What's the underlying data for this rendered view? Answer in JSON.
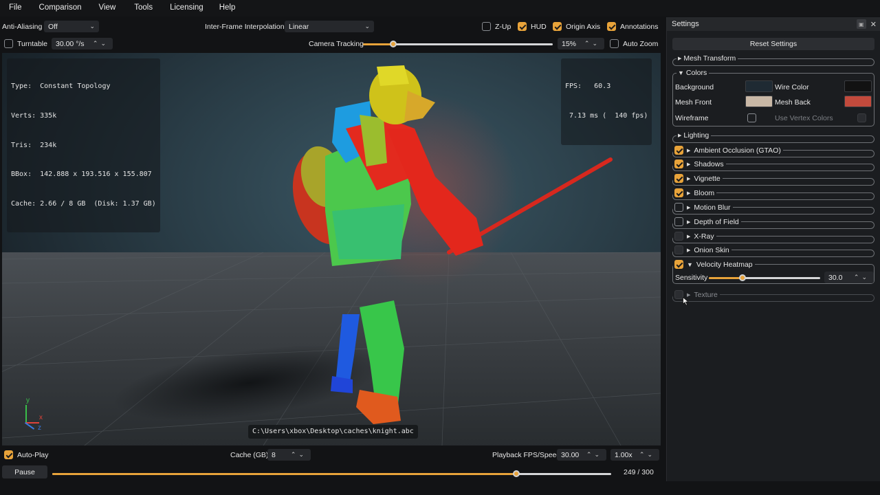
{
  "menu": [
    "File",
    "Comparison",
    "View",
    "Tools",
    "Licensing",
    "Help"
  ],
  "toolbar": {
    "anti_aliasing_label": "Anti-Aliasing",
    "anti_aliasing_value": "Off",
    "interp_label": "Inter-Frame Interpolation",
    "interp_value": "Linear",
    "zup_label": "Z-Up",
    "hud_label": "HUD",
    "origin_axis_label": "Origin Axis",
    "annotations_label": "Annotations",
    "turntable_label": "Turntable",
    "turntable_value": "30.00 °/s",
    "camera_tracking_label": "Camera Tracking",
    "camera_tracking_fraction": 0.16,
    "zoom_value": "15%",
    "auto_zoom_label": "Auto Zoom",
    "checks": {
      "zup": false,
      "hud": true,
      "origin_axis": true,
      "annotations": true,
      "turntable": false,
      "auto_zoom": false
    }
  },
  "viewport": {
    "info": {
      "type": "Type:  Constant Topology",
      "verts": "Verts: 335k",
      "tris": "Tris:  234k",
      "bbox": "BBox:  142.888 x 193.516 x 155.807",
      "cache": "Cache: 2.66 / 8 GB  (Disk: 1.37 GB)"
    },
    "fps_line1": "FPS:   60.3",
    "fps_line2": " 7.13 ms (  140 fps)",
    "file_path": "C:\\Users\\xbox\\Desktop\\caches\\knight.abc",
    "axis": {
      "y": "y",
      "x": "x",
      "z": "z"
    }
  },
  "bottom": {
    "autoplay_label": "Auto-Play",
    "autoplay_checked": true,
    "cache_label": "Cache (GB)",
    "cache_value": "8",
    "playback_label": "Playback FPS/Speed",
    "playback_fps": "30.00",
    "playback_speed": "1.00x",
    "pause_label": "Pause",
    "frame_counter": "249 / 300",
    "timeline_fraction": 0.83
  },
  "settings": {
    "title": "Settings",
    "reset_label": "Reset Settings",
    "mesh_transform": "Mesh Transform",
    "colors_title": "Colors",
    "background_label": "Background",
    "wire_color_label": "Wire Color",
    "mesh_front_label": "Mesh Front",
    "mesh_back_label": "Mesh Back",
    "wireframe_label": "Wireframe",
    "vertex_colors_label": "Use Vertex Colors",
    "colors": {
      "background": "#1f2a33",
      "wire": "#121212",
      "mesh_front": "#c9b8a6",
      "mesh_back": "#c24a3c",
      "accent": "#e8a33a"
    },
    "lighting": "Lighting",
    "effects": [
      {
        "label": "Ambient Occlusion (GTAO)",
        "checked": true
      },
      {
        "label": "Shadows",
        "checked": true
      },
      {
        "label": "Vignette",
        "checked": true
      },
      {
        "label": "Bloom",
        "checked": true
      },
      {
        "label": "Motion Blur",
        "checked": false
      },
      {
        "label": "Depth of Field",
        "checked": false
      },
      {
        "label": "X-Ray",
        "checked": false
      },
      {
        "label": "Onion Skin",
        "checked": false
      }
    ],
    "velocity_label": "Velocity Heatmap",
    "sensitivity_label": "Sensitivity",
    "sensitivity_value": "30.0",
    "sensitivity_fraction": 0.3,
    "texture_label": "Texture"
  }
}
